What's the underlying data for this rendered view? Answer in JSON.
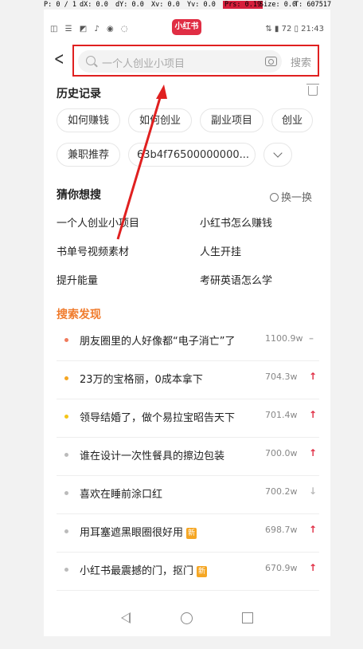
{
  "debug_overlay": {
    "pointer": "P: 0 / 1",
    "dx": "dX: 0.0",
    "dy": "dY: 0.0",
    "xv": "Xv: 0.0",
    "yv": "Yv: 0.0",
    "prs": "Prs: 0.19",
    "size": "Size: 0.0",
    "t": "T: 607517"
  },
  "status_bar": {
    "left_icons": "◫ ☰ ◩ ♪ ◉ ◌",
    "app_logo": "小红书",
    "right": "⇅ ▮ 72 ▯ 21:43"
  },
  "search": {
    "placeholder": "一个人创业小项目",
    "button_label": "搜索"
  },
  "history": {
    "title": "历史记录",
    "chips": [
      "如何赚钱",
      "如何创业",
      "副业项目",
      "创业",
      "兼职推荐",
      "63b4f76500000000..."
    ]
  },
  "guess": {
    "title": "猜你想搜",
    "refresh_label": "换一换",
    "items": [
      "一个人创业小项目",
      "小红书怎么赚钱",
      "书单号视频素材",
      "人生开挂",
      "提升能量",
      "考研英语怎么学"
    ]
  },
  "discover": {
    "title": "搜索发现",
    "items": [
      {
        "title": "朋友圈里的人好像都“电子消亡”了",
        "count": "1100.9w",
        "trend": "–",
        "dot": "#f07b5c",
        "trend_color": "#bbbbbb",
        "badge": ""
      },
      {
        "title": "23万的宝格丽，0成本拿下",
        "count": "704.3w",
        "trend": "↑",
        "dot": "#f5a623",
        "trend_color": "#e02e44",
        "badge": ""
      },
      {
        "title": "领导结婚了，做个易拉宝昭告天下",
        "count": "701.4w",
        "trend": "↑",
        "dot": "#f5c518",
        "trend_color": "#e02e44",
        "badge": ""
      },
      {
        "title": "谁在设计一次性餐具的擦边包装",
        "count": "700.0w",
        "trend": "↑",
        "dot": "#bbbbbb",
        "trend_color": "#e02e44",
        "badge": ""
      },
      {
        "title": "喜欢在睡前涂口红",
        "count": "700.2w",
        "trend": "↓",
        "dot": "#bbbbbb",
        "trend_color": "#bbbbbb",
        "badge": ""
      },
      {
        "title": "用耳塞遮黑眼圈很好用",
        "count": "698.7w",
        "trend": "↑",
        "dot": "#bbbbbb",
        "trend_color": "#e02e44",
        "badge": "新"
      },
      {
        "title": "小红书最震撼的门，抠门",
        "count": "670.9w",
        "trend": "↑",
        "dot": "#bbbbbb",
        "trend_color": "#e02e44",
        "badge": "新"
      }
    ]
  },
  "annotation_color": "#e02020"
}
